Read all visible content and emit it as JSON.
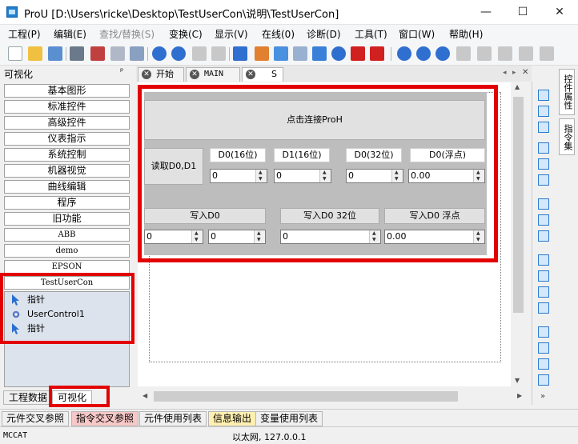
{
  "window": {
    "title": "ProU [D:\\Users\\ricke\\Desktop\\TestUserCon\\说明\\TestUserCon]"
  },
  "menu": [
    "工程(P)",
    "编辑(E)",
    "查找/替换(S)",
    "变换(C)",
    "显示(V)",
    "在线(0)",
    "诊断(D)",
    "工具(T)",
    "窗口(W)",
    "帮助(H)"
  ],
  "left_panel": {
    "title": "可视化",
    "pin": "ᵖ",
    "categories": [
      "基本图形",
      "标准控件",
      "高级控件",
      "仪表指示",
      "系统控制",
      "机器视觉",
      "曲线编辑",
      "程序",
      "旧功能",
      "ABB",
      "demo",
      "EPSON"
    ],
    "custom_group": "TestUserCon",
    "custom_items": [
      "指针",
      "UserControl1",
      "指针"
    ],
    "tabs": [
      "工程数据",
      "可视化"
    ]
  },
  "doc_tabs": [
    {
      "label": "开始"
    },
    {
      "label": "MAIN"
    },
    {
      "label": "S"
    }
  ],
  "design": {
    "connect_button": "点击连接ProH",
    "read_label": "读取D0,D1",
    "headers": [
      "D0(16位)",
      "D1(16位)",
      "D0(32位)",
      "D0(浮点)"
    ],
    "read_values": [
      "0",
      "0",
      "0",
      "0.00"
    ],
    "write_buttons": [
      "写入D0",
      "写入D0 32位",
      "写入D0 浮点"
    ],
    "write_values": [
      "0",
      "0",
      "0",
      "0.00"
    ]
  },
  "right_tabs": [
    "控件属性",
    "指令集"
  ],
  "bottom_tabs": [
    "元件交叉参照",
    "指令交叉参照",
    "元件使用列表",
    "信息输出",
    "变量使用列表"
  ],
  "status": {
    "left": "MCCAT",
    "center": "以太网, 127.0.0.1"
  },
  "colors": {
    "highlight_red": "#e30000",
    "design_bg": "#bdbdbd"
  }
}
